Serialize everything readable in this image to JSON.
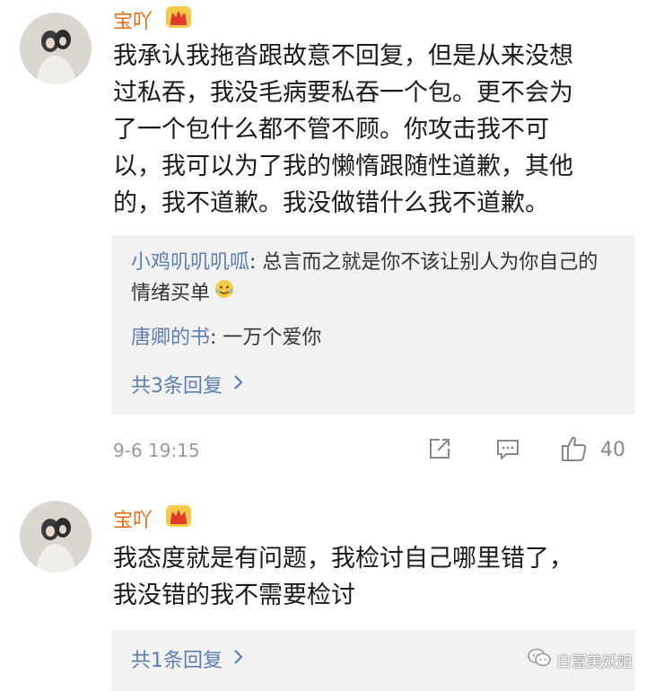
{
  "comments": [
    {
      "username": "宝吖",
      "text_lines": [
        "我承认我拖沓跟故意不回复，但是从来没想",
        "过私吞，我没毛病要私吞一个包。更不会为",
        "了一个包什么都不管不顾。你攻击我不可",
        "以，我可以为了我的懒惰跟随性道歉，其他",
        "的，我不道歉。我没做错什么我不道歉。"
      ],
      "replies": [
        {
          "author": "小鸡叽叽叽呱",
          "sep": ": ",
          "text": "总言而之就是你不该让别人为你自己的情绪买单"
        },
        {
          "author": "唐卿的书",
          "sep": ": ",
          "text": "一万个爱你"
        }
      ],
      "more_replies": "共3条回复",
      "time": "9-6 19:15",
      "like_count": "40"
    },
    {
      "username": "宝吖",
      "text_lines": [
        "我态度就是有问题，我检讨自己哪里错了，",
        "我没错的我不需要检讨"
      ],
      "more_replies": "共1条回复"
    }
  ],
  "watermark": "白富美妖姐",
  "colors": {
    "username": "#e86a12",
    "link": "#5b7fb0",
    "reply_bg": "#f2f2f2"
  },
  "icons": [
    "crown-icon",
    "share-icon",
    "comment-icon",
    "like-icon",
    "chevron-right-icon",
    "wechat-icon"
  ]
}
